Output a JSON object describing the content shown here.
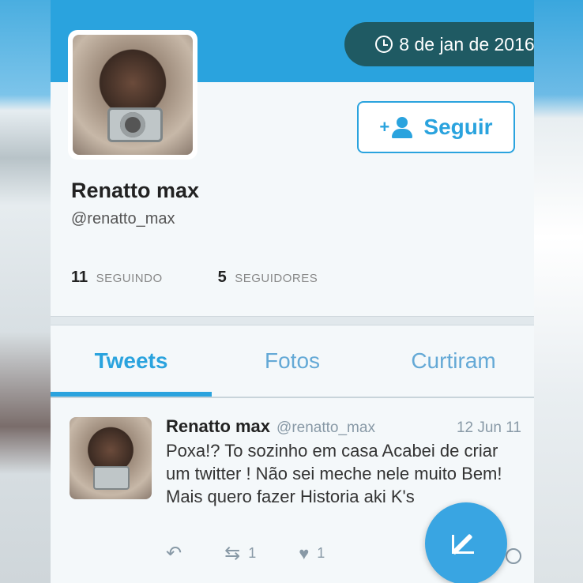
{
  "header": {
    "date": "8 de jan de 2016",
    "follow_label": "Seguir"
  },
  "profile": {
    "name": "Renatto max",
    "handle": "@renatto_max",
    "following_count": "11",
    "following_label": "SEGUINDO",
    "followers_count": "5",
    "followers_label": "SEGUIDORES"
  },
  "tabs": [
    {
      "label": "Tweets",
      "active": true
    },
    {
      "label": "Fotos",
      "active": false
    },
    {
      "label": "Curtiram",
      "active": false
    }
  ],
  "tweet": {
    "name": "Renatto max",
    "handle": "@renatto_max",
    "date": "12 Jun 11",
    "text": "Poxa!? To sozinho em casa Acabei de criar um twitter ! Não sei meche nele muito Bem! Mais quero fazer Historia aki K's",
    "retweets": "1",
    "likes": "1"
  },
  "icons": [
    "clock-icon",
    "add-user-icon",
    "reply-icon",
    "retweet-icon",
    "heart-icon",
    "compose-icon"
  ],
  "colors": {
    "accent": "#2aa3de",
    "date_pill": "#1f5a63"
  }
}
